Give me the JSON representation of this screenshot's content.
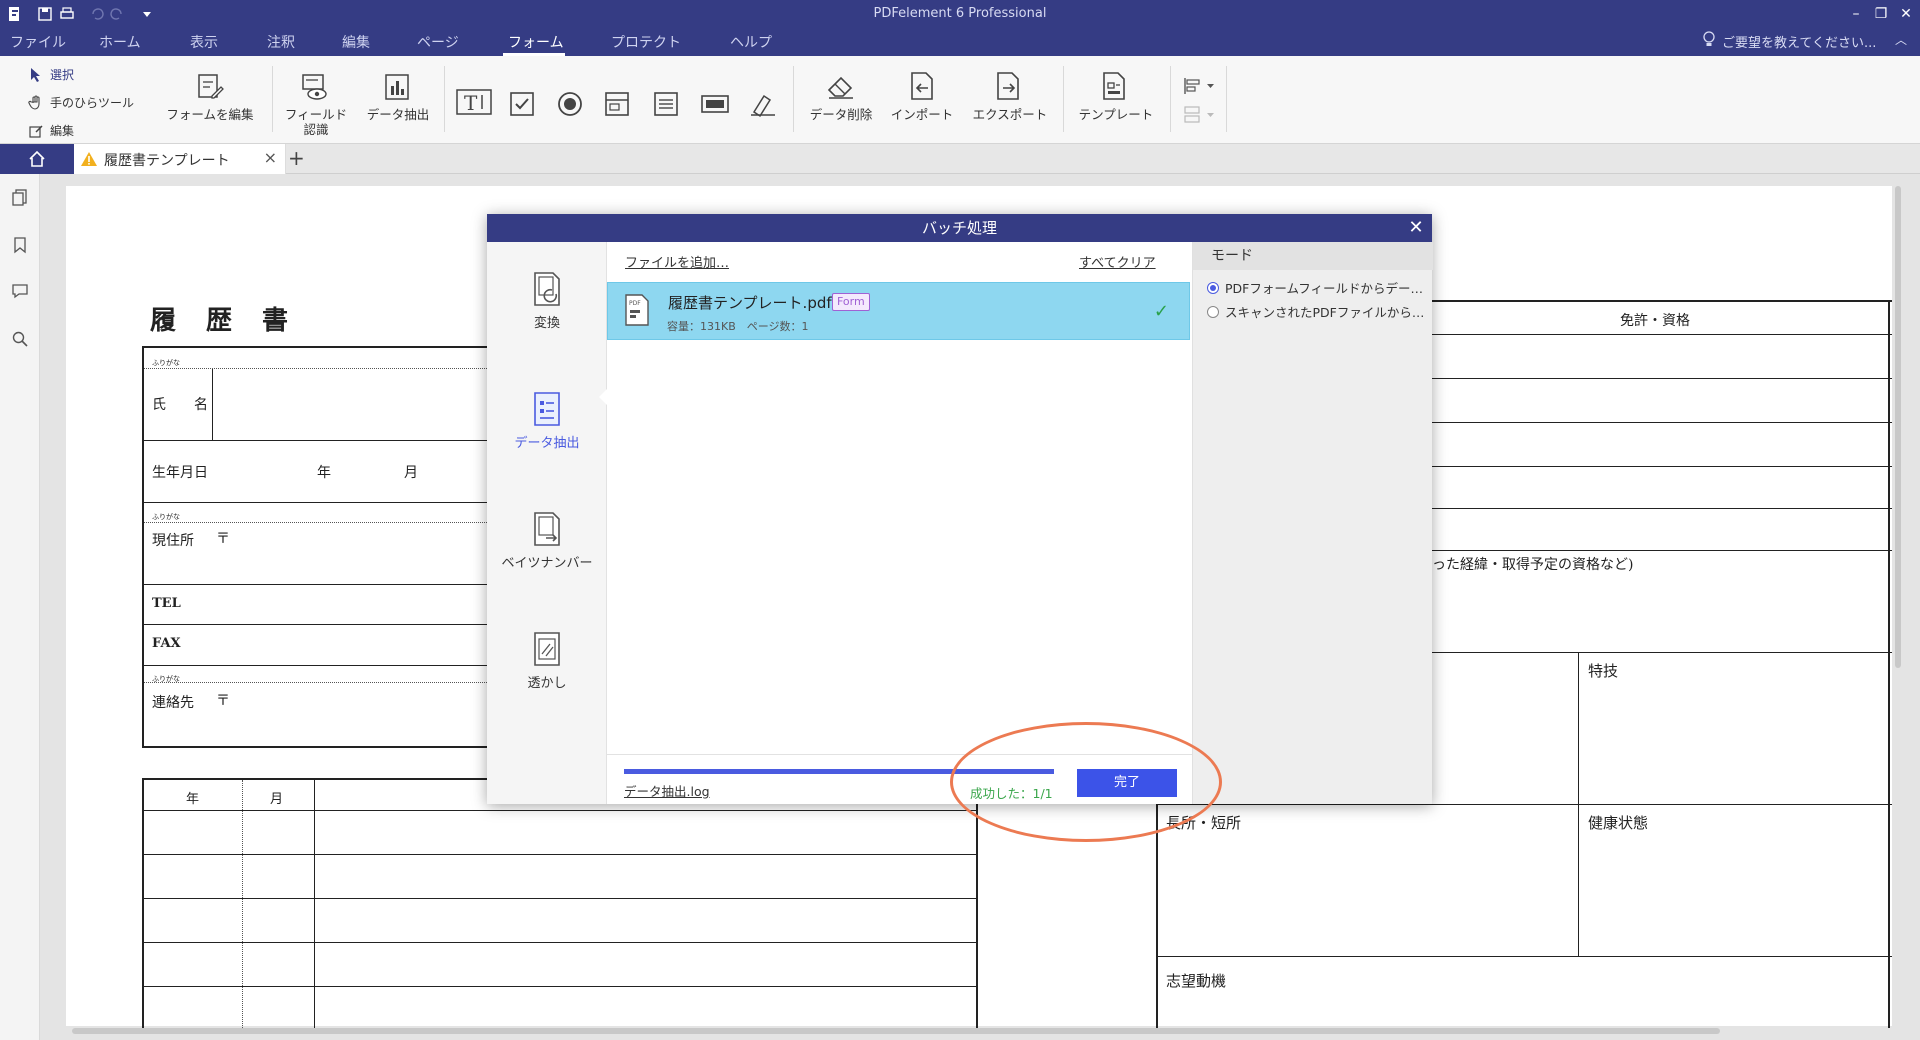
{
  "app": {
    "title": "PDFelement 6 Professional",
    "window_controls": [
      "–",
      "❐",
      "✕"
    ]
  },
  "menu": {
    "items": [
      "ファイル",
      "ホーム",
      "表示",
      "注釈",
      "編集",
      "ページ",
      "フォーム",
      "プロテクト",
      "ヘルプ"
    ],
    "active": "フォーム",
    "feedback": "ご要望を教えてください..."
  },
  "ribbon": {
    "select": "選択",
    "hand": "手のひらツール",
    "edit": "編集",
    "edit_form": "フォームを編集",
    "field_recog_1": "フィールド",
    "field_recog_2": "認識",
    "data_extract": "データ抽出",
    "data_delete": "データ削除",
    "import": "インポート",
    "export": "エクスポート",
    "template": "テンプレート"
  },
  "tabs": {
    "document": "履歴書テンプレート",
    "close": "×",
    "add": "+"
  },
  "document": {
    "title": "履　歴　書",
    "furigana": "ふりがな",
    "name": "氏　　名",
    "birth": "生年月日",
    "year": "年",
    "month": "月",
    "address": "現住所",
    "postal": "〒",
    "tel": "TEL",
    "fax": "FAX",
    "contact": "連絡先",
    "license": "免許・資格",
    "qualification_note": "った経緯・取得予定の資格など)",
    "skill": "特技",
    "strength": "長所・短所",
    "health": "健康状態",
    "motivation": "志望動機",
    "hist_year": "年",
    "hist_month": "月"
  },
  "dialog": {
    "title": "バッチ処理",
    "close": "✕",
    "nav": [
      {
        "label": "変換",
        "icon": "convert-icon"
      },
      {
        "label": "データ抽出",
        "icon": "data-extract-icon"
      },
      {
        "label": "ベイツナンバー",
        "icon": "bates-number-icon"
      },
      {
        "label": "透かし",
        "icon": "watermark-icon"
      }
    ],
    "active_nav": "データ抽出",
    "add_files": "ファイルを追加…",
    "clear_all": "すべてクリア",
    "file": {
      "name": "履歴書テンプレート.pdf",
      "badge": "Form",
      "meta": "容量：131KB　ページ数：1",
      "status": "✓"
    },
    "progress": 1.0,
    "log_link": "データ抽出.log",
    "success": "成功した：1/1",
    "done_button": "完了",
    "mode": {
      "header": "モード",
      "options": [
        "PDFフォームフィールドからデー…",
        "スキャンされたPDFファイルから…"
      ],
      "selected": 0
    }
  },
  "colors": {
    "chrome": "#353c84",
    "accent": "#4a5be0",
    "file_row": "#8ed7f0",
    "success": "#3aa64b",
    "highlight": "#ec7a52"
  }
}
